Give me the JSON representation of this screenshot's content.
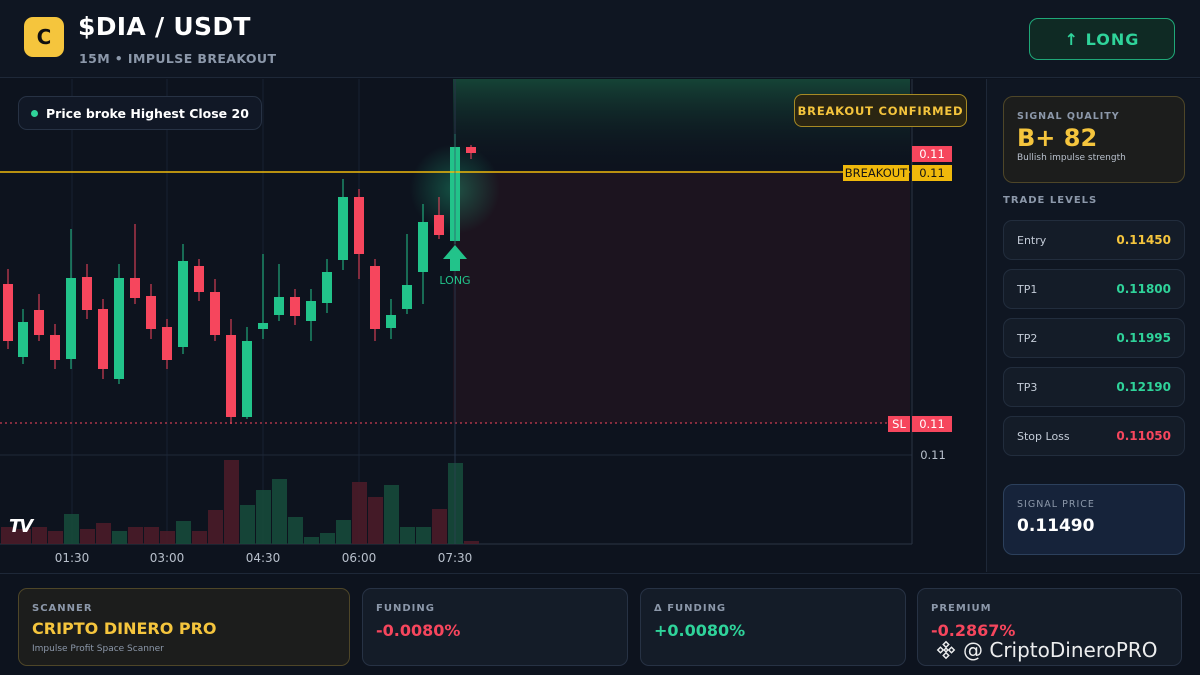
{
  "header": {
    "logo_letter": "C",
    "pair": "$DIA / USDT",
    "subtitle": "15M • IMPULSE BREAKOUT",
    "action_label": "↑ LONG"
  },
  "chart": {
    "info_chip": "Price broke Highest Close 20",
    "badge": "BREAKOUT CONFIRMED",
    "price_tag": "0.11",
    "breakout_label": "BREAKOUT",
    "breakout_value": "0.11",
    "sl_label": "SL",
    "sl_value": "0.11",
    "volume_scale_label": "0.11",
    "signal_label": "LONG",
    "time_labels": [
      "01:30",
      "03:00",
      "04:30",
      "06:00",
      "07:30"
    ],
    "tv_logo": "TV",
    "colors": {
      "up": "#22c38a",
      "down": "#f6465d",
      "breakout": "#f0b90b",
      "sl": "#f6465d"
    }
  },
  "panel": {
    "quality_label": "SIGNAL QUALITY",
    "quality_value": "B+ 82",
    "quality_desc": "Bullish impulse strength",
    "levels_title": "TRADE LEVELS",
    "levels": [
      {
        "name": "Entry",
        "value": "0.11450",
        "color": "#f5c53d"
      },
      {
        "name": "TP1",
        "value": "0.11800",
        "color": "#2fd39a"
      },
      {
        "name": "TP2",
        "value": "0.11995",
        "color": "#2fd39a"
      },
      {
        "name": "TP3",
        "value": "0.12190",
        "color": "#2fd39a"
      },
      {
        "name": "Stop Loss",
        "value": "0.11050",
        "color": "#f6465d"
      }
    ],
    "signal_price_label": "SIGNAL PRICE",
    "signal_price_value": "0.11490"
  },
  "bottom": {
    "scanner_label": "SCANNER",
    "scanner_value": "CRIPTO DINERO PRO",
    "scanner_desc": "Impulse Profit Space Scanner",
    "funding_label": "FUNDING",
    "funding_value": "-0.0080%",
    "delta_funding_label": "Δ FUNDING",
    "delta_funding_value": "+0.0080%",
    "premium_label": "PREMIUM",
    "premium_value": "-0.2867%"
  },
  "watermark": "@ CriptoDineroPRO"
}
